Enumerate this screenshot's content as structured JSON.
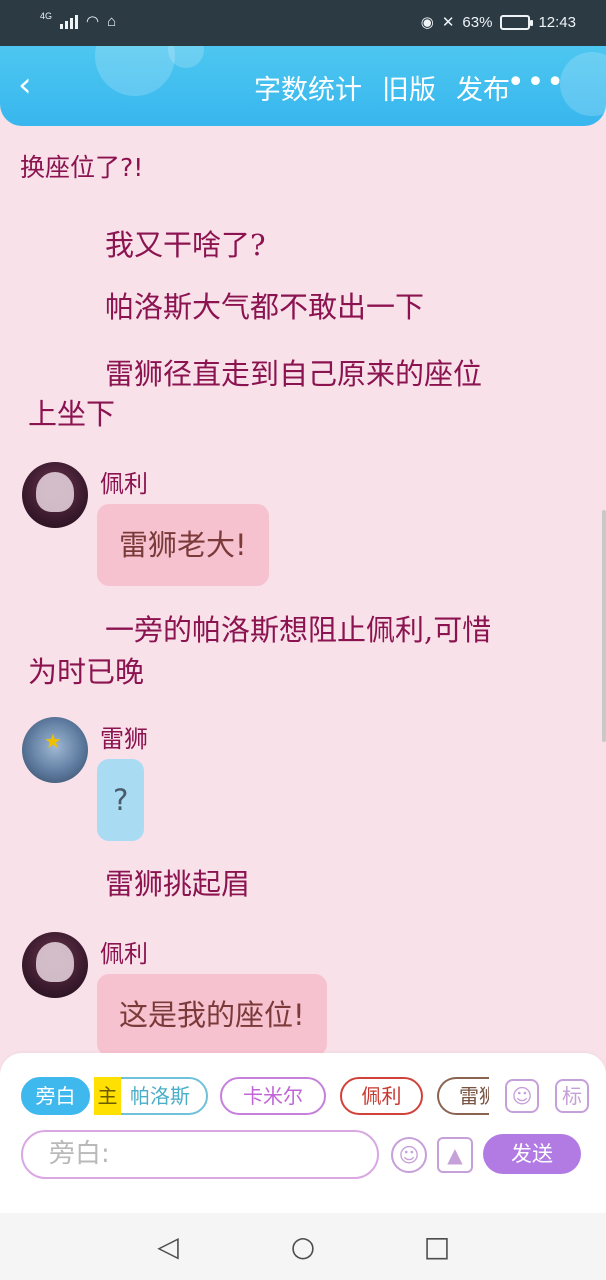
{
  "status_bar": {
    "network": "4G",
    "battery_percent": "63%",
    "time": "12:43"
  },
  "header": {
    "actions": [
      "字数统计",
      "旧版",
      "发布"
    ],
    "more_label": "•••"
  },
  "story": {
    "top_text": "换座位了?!",
    "paragraphs": [
      "我又干啥了?",
      "帕洛斯大气都不敢出一下",
      "雷狮径直走到自己原来的座位",
      "上坐下"
    ],
    "msg1": {
      "speaker": "佩利",
      "text": "雷狮老大!"
    },
    "paragraph2": [
      "一旁的帕洛斯想阻止佩利,可惜",
      "为时已晚"
    ],
    "msg2": {
      "speaker": "雷狮",
      "text": "?"
    },
    "paragraph3": "雷狮挑起眉",
    "msg3": {
      "speaker": "佩利",
      "text": "这是我的座位!"
    }
  },
  "composer": {
    "chips": {
      "narration": "旁白",
      "main_tag": "主",
      "palos": "帕洛斯",
      "kamir": "卡米尔",
      "peri": "佩利",
      "lei_partial": "雷狮"
    },
    "input_placeholder": "旁白:",
    "send_label": "发送",
    "mark_label": "标"
  },
  "colors": {
    "background": "#f9e1ea",
    "header": "#3fb8ee",
    "narration_text": "#8b1450",
    "send_button": "#b27be4"
  }
}
